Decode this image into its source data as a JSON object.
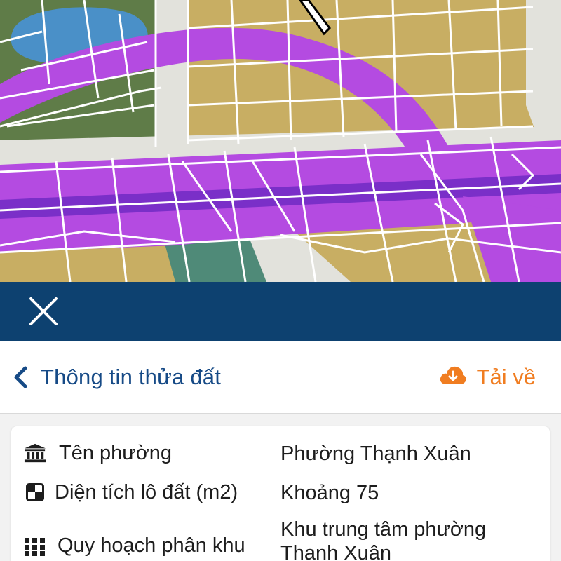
{
  "colors": {
    "map_land": "#c8ae63",
    "map_green": "#5f7c48",
    "map_water": "#4a90c8",
    "map_route": "#b44be1",
    "map_route_dark": "#7a2fc8",
    "map_teal": "#4f8a78",
    "map_road": "#e2e2dc",
    "modal_bar": "#0d4170",
    "header_text": "#164a86",
    "download_accent": "#f07d21",
    "body_text": "#1d1d1d"
  },
  "header": {
    "back_icon": "chevron-left-icon",
    "title": "Thông tin thửa đất",
    "download_icon": "cloud-download-icon",
    "download_label": "Tải về"
  },
  "modal": {
    "close_icon": "close-icon"
  },
  "info": {
    "rows": [
      {
        "icon": "institution-icon",
        "label": "Tên phường",
        "value": "Phường Thạnh Xuân"
      },
      {
        "icon": "quadrant-square-icon",
        "label": "Diện tích lô đất (m2)",
        "value": "Khoảng 75"
      },
      {
        "icon": "grid-dots-icon",
        "label": "Quy hoạch phân khu",
        "value": "Khu trung tâm phường Thạnh Xuân"
      }
    ]
  }
}
